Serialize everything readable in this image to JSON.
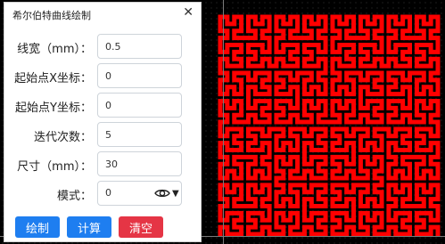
{
  "window": {
    "title": "希尔伯特曲线绘制",
    "close_glyph": "✕"
  },
  "form": {
    "line_width": {
      "label": "线宽（mm）：",
      "value": "0.5"
    },
    "start_x": {
      "label": "起始点X坐标：",
      "value": "0"
    },
    "start_y": {
      "label": "起始点Y坐标：",
      "value": "0"
    },
    "iterations": {
      "label": "迭代次数：",
      "value": "5"
    },
    "size": {
      "label": "尺寸（mm）：",
      "value": "30"
    },
    "mode": {
      "label": "模式：",
      "value": "0"
    }
  },
  "buttons": {
    "draw": "绘制",
    "calculate": "计算",
    "clear": "清空"
  },
  "colors": {
    "draw": "#1e7ef0",
    "calculate": "#1e7ef0",
    "clear": "#e53545",
    "curve": "#ff0000"
  },
  "icons": {
    "mode_icon": "eye-icon",
    "dropdown": "chevron-down-icon",
    "close": "close-icon"
  },
  "curve": {
    "order": 5
  }
}
